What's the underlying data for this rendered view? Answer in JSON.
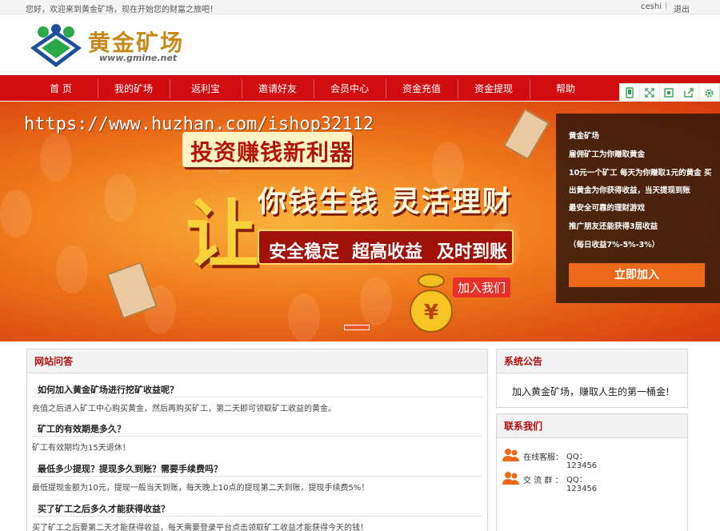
{
  "topbar": {
    "welcome": "您好，欢迎来到黄金矿场，现在开始您的财富之旅吧！",
    "username": "ceshi",
    "separator": "|",
    "logout": "退出"
  },
  "header": {
    "logo_text": "黄金矿场",
    "logo_url": "www.gmine.net"
  },
  "nav": {
    "items": [
      {
        "label": "首 页"
      },
      {
        "label": "我的矿场"
      },
      {
        "label": "返利宝"
      },
      {
        "label": "邀请好友"
      },
      {
        "label": "会员中心"
      },
      {
        "label": "资金充值"
      },
      {
        "label": "资金提现"
      },
      {
        "label": "帮助"
      }
    ]
  },
  "toolbox": {
    "icons": [
      "mobile-icon",
      "fullscreen-icon",
      "qrcode-icon",
      "share-icon",
      "settings-icon"
    ]
  },
  "banner": {
    "watermark": "https://www.huzhan.com/ishop32112",
    "headline": "投资赚钱新利器",
    "big_char": "让",
    "slogan": "你钱生钱 灵活理财",
    "features": [
      "安全稳定",
      "超高收益",
      "及时到账"
    ],
    "join_small": "加入我们",
    "bag_char": "¥"
  },
  "info_panel": {
    "lines": [
      "黄金矿场",
      "雇佣矿工为你赚取黄金",
      "10元一个矿工 每天为你赚取1元的黄金 买",
      "出黄金为你获得收益，当天提现到账",
      "最安全可靠的理财游戏",
      "推广朋友还能获得3层收益",
      "（每日收益7%-5%-3%）"
    ],
    "button": "立即加入"
  },
  "faq": {
    "title": "网站问答",
    "items": [
      {
        "q": "如何加入黄金矿场进行挖矿收益呢？",
        "a": "充值之后进入矿工中心购买黄金，然后再购买矿工，第二天即可领取矿工收益的黄金。"
      },
      {
        "q": "矿工的有效期是多久？",
        "a": "矿工有效期均为15天退休！"
      },
      {
        "q": "最低多少提现？提现多久到账？需要手续费吗？",
        "a": "最低提现金额为10元，提现一般当天到账，每天晚上10点的提现第二天到账，提现手续费5%！"
      },
      {
        "q": "买了矿工之后多久才能获得收益？",
        "a": "买了矿工之后要第二天才能获得收益，每天需要登录平台点击领取矿工收益才能获得今天的钱！"
      }
    ]
  },
  "notice": {
    "title": "系统公告",
    "text": "加入黄金矿场，赚取人生的第一桶金!"
  },
  "contact": {
    "title": "联系我们",
    "rows": [
      {
        "label": "在线客服：",
        "value": "QQ：123456"
      },
      {
        "label": "交 流 群 ：",
        "value": "QQ：123456"
      }
    ]
  }
}
